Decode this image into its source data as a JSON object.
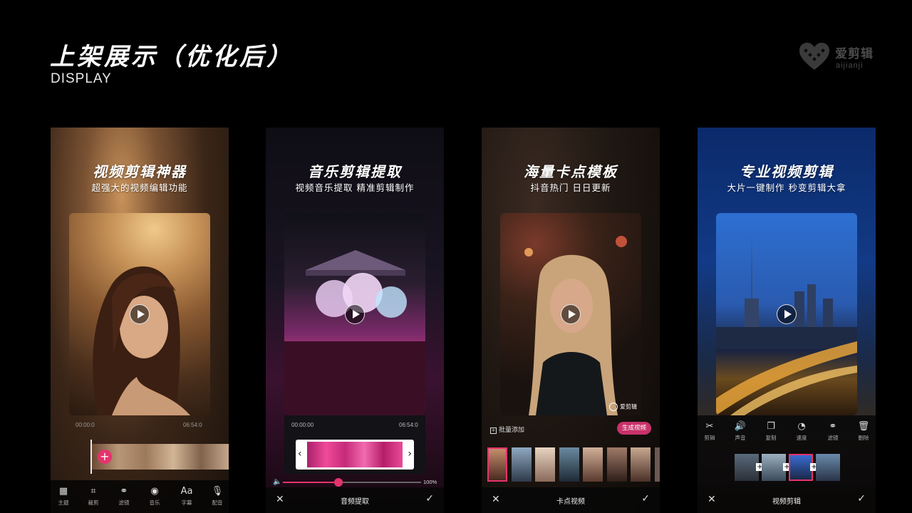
{
  "header": {
    "title": "上架展示（优化后）",
    "subtitle": "DISPLAY",
    "logo_name": "爱剪辑",
    "logo_sub": "aijianji"
  },
  "panels": [
    {
      "heading": "视频剪辑神器",
      "sub": "超强大的视频编辑功能",
      "time_start": "00:00:0",
      "time_end": "06:54:0",
      "tools": [
        {
          "icon": "grid-icon",
          "label": "主题"
        },
        {
          "icon": "crop-icon",
          "label": "裁剪"
        },
        {
          "icon": "filter-icon",
          "label": "滤镜"
        },
        {
          "icon": "music-icon",
          "label": "音乐"
        },
        {
          "icon": "text-icon",
          "label": "字幕",
          "glyph": "Aa"
        },
        {
          "icon": "microphone-icon",
          "label": "配音"
        }
      ]
    },
    {
      "heading": "音乐剪辑提取",
      "sub": "视频音乐提取 精准剪辑制作",
      "time_start": "00:00:00",
      "time_end": "06:54:0",
      "volume_value": "100%",
      "volume_level": 0.4,
      "bottom_label": "音频提取"
    },
    {
      "heading": "海量卡点模板",
      "sub": "抖音热门 日日更新",
      "watermark": "爱剪辑",
      "batch_add": "批量添加",
      "generate": "生成视频",
      "bottom_label": "卡点视频"
    },
    {
      "heading": "专业视频剪辑",
      "sub": "大片一键制作 秒变剪辑大拿",
      "tools": [
        {
          "icon": "scissors-icon",
          "label": "剪辑"
        },
        {
          "icon": "speaker-icon",
          "label": "声音"
        },
        {
          "icon": "copy-icon",
          "label": "复制"
        },
        {
          "icon": "speed-icon",
          "label": "速度"
        },
        {
          "icon": "filter-icon",
          "label": "滤镜"
        },
        {
          "icon": "trash-icon",
          "label": "删除"
        }
      ],
      "bottom_label": "视频剪辑"
    }
  ],
  "colors": {
    "accent_pink": "#e5336c",
    "logo_gray": "#4a4a4a",
    "city_blue": "#2d6fd1"
  }
}
